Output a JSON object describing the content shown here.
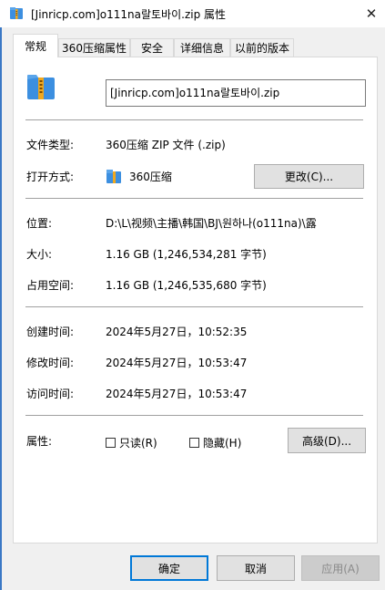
{
  "window": {
    "title": "[Jinricp.com]o111na랄토바이.zip 属性",
    "close_glyph": "✕"
  },
  "tabs": [
    {
      "label": "常规",
      "active": true
    },
    {
      "label": "360压缩属性",
      "active": false
    },
    {
      "label": "安全",
      "active": false
    },
    {
      "label": "详细信息",
      "active": false
    },
    {
      "label": "以前的版本",
      "active": false
    }
  ],
  "general": {
    "file_name": "[Jinricp.com]o111na랄토바이.zip",
    "file_type": {
      "label": "文件类型:",
      "value": "360压缩 ZIP 文件 (.zip)"
    },
    "opens_with": {
      "label": "打开方式:",
      "value": "360压缩",
      "change_button": "更改(C)..."
    },
    "location": {
      "label": "位置:",
      "value": "D:\\L\\视频\\主播\\韩国\\BJ\\원하나(o111na)\\露"
    },
    "size": {
      "label": "大小:",
      "value": "1.16 GB (1,246,534,281 字节)"
    },
    "size_on_disk": {
      "label": "占用空间:",
      "value": "1.16 GB (1,246,535,680 字节)"
    },
    "created": {
      "label": "创建时间:",
      "value": "2024年5月27日，10:52:35"
    },
    "modified": {
      "label": "修改时间:",
      "value": "2024年5月27日，10:53:47"
    },
    "accessed": {
      "label": "访问时间:",
      "value": "2024年5月27日，10:53:47"
    },
    "attributes": {
      "label": "属性:",
      "readonly": {
        "label": "只读(R)",
        "checked": false
      },
      "hidden": {
        "label": "隐藏(H)",
        "checked": false
      },
      "advanced_button": "高级(D)..."
    }
  },
  "footer": {
    "ok": "确定",
    "cancel": "取消",
    "apply": "应用(A)"
  },
  "colors": {
    "accent": "#0078d7",
    "icon_blue": "#3c8fe0",
    "icon_orange": "#f0a81e"
  },
  "icons": {
    "title": "zip-archive-icon",
    "file": "zip-archive-icon",
    "open_with": "360-zip-app-icon"
  }
}
